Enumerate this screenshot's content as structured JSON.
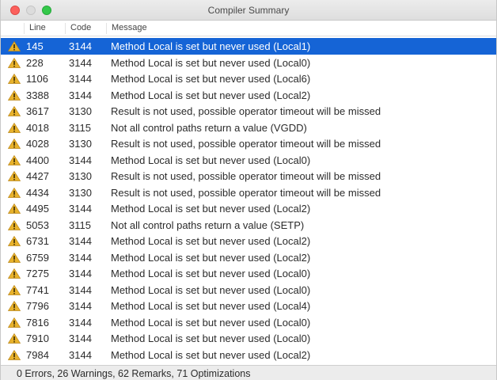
{
  "window": {
    "title": "Compiler Summary"
  },
  "columns": {
    "line": "Line",
    "code": "Code",
    "message": "Message"
  },
  "rows": [
    {
      "line": "145",
      "code": "3144",
      "message": "Method Local is set but never used (Local1)",
      "selected": true
    },
    {
      "line": "228",
      "code": "3144",
      "message": "Method Local is set but never used (Local0)"
    },
    {
      "line": "1106",
      "code": "3144",
      "message": "Method Local is set but never used (Local6)"
    },
    {
      "line": "3388",
      "code": "3144",
      "message": "Method Local is set but never used (Local2)"
    },
    {
      "line": "3617",
      "code": "3130",
      "message": "Result is not used, possible operator timeout will be missed"
    },
    {
      "line": "4018",
      "code": "3115",
      "message": "Not all control paths return a value (VGDD)"
    },
    {
      "line": "4028",
      "code": "3130",
      "message": "Result is not used, possible operator timeout will be missed"
    },
    {
      "line": "4400",
      "code": "3144",
      "message": "Method Local is set but never used (Local0)"
    },
    {
      "line": "4427",
      "code": "3130",
      "message": "Result is not used, possible operator timeout will be missed"
    },
    {
      "line": "4434",
      "code": "3130",
      "message": "Result is not used, possible operator timeout will be missed"
    },
    {
      "line": "4495",
      "code": "3144",
      "message": "Method Local is set but never used (Local2)"
    },
    {
      "line": "5053",
      "code": "3115",
      "message": "Not all control paths return a value (SETP)"
    },
    {
      "line": "6731",
      "code": "3144",
      "message": "Method Local is set but never used (Local2)"
    },
    {
      "line": "6759",
      "code": "3144",
      "message": "Method Local is set but never used (Local2)"
    },
    {
      "line": "7275",
      "code": "3144",
      "message": "Method Local is set but never used (Local0)"
    },
    {
      "line": "7741",
      "code": "3144",
      "message": "Method Local is set but never used (Local0)"
    },
    {
      "line": "7796",
      "code": "3144",
      "message": "Method Local is set but never used (Local4)"
    },
    {
      "line": "7816",
      "code": "3144",
      "message": "Method Local is set but never used (Local0)"
    },
    {
      "line": "7910",
      "code": "3144",
      "message": "Method Local is set but never used (Local0)"
    },
    {
      "line": "7984",
      "code": "3144",
      "message": "Method Local is set but never used (Local2)"
    }
  ],
  "status": {
    "summary": "0 Errors, 26 Warnings, 62 Remarks, 71 Optimizations"
  },
  "icons": {
    "row": "warning-icon"
  },
  "colors": {
    "selection": "#1564d6",
    "warning": "#e8b22b"
  }
}
